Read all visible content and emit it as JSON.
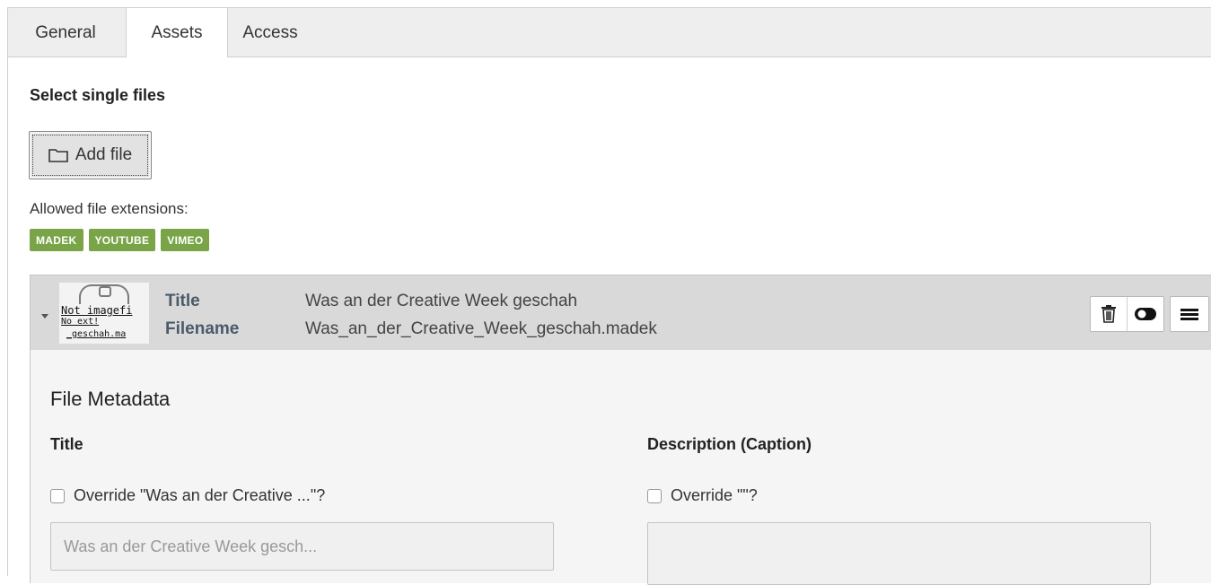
{
  "tabs": [
    {
      "label": "General"
    },
    {
      "label": "Assets"
    },
    {
      "label": "Access"
    }
  ],
  "section": {
    "title": "Select single files",
    "add_file_label": "Add file",
    "allowed_label": "Allowed file extensions:",
    "extensions": [
      "MADEK",
      "YOUTUBE",
      "VIMEO"
    ]
  },
  "record": {
    "thumb_lines": [
      "Not imagefi",
      "No ext!",
      "_geschah.ma"
    ],
    "title_label": "Title",
    "title_value": "Was an der Creative Week geschah",
    "filename_label": "Filename",
    "filename_value": "Was_an_der_Creative_Week_geschah.madek"
  },
  "metadata": {
    "heading": "File Metadata",
    "title_field": {
      "label": "Title",
      "override_label": "Override \"Was an der Creative ...\"?",
      "placeholder": "Was an der Creative Week gesch..."
    },
    "description_field": {
      "label": "Description (Caption)",
      "override_label": "Override \"\"?",
      "placeholder": ""
    }
  },
  "colors": {
    "badge": "#79a548",
    "tabbar": "#eeeeee",
    "record_header": "#d9d9d9"
  }
}
